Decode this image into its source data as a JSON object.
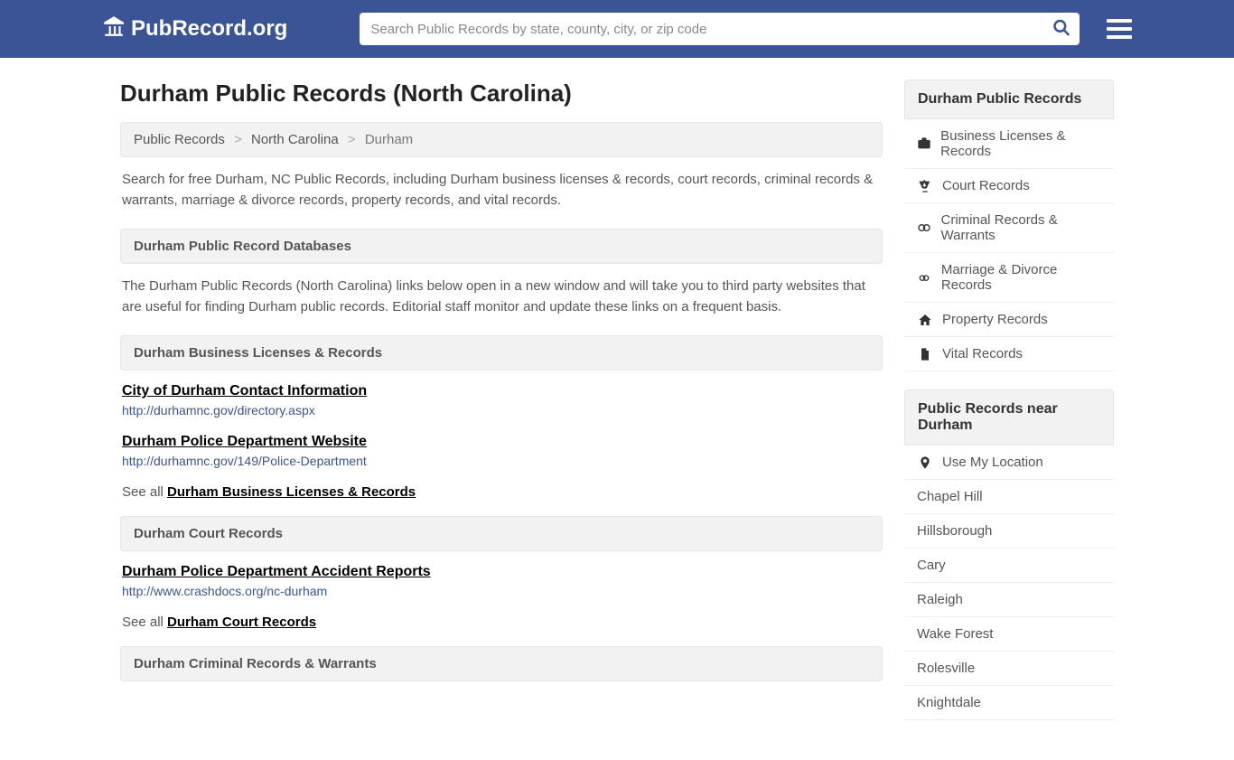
{
  "header": {
    "logo_text": "PubRecord.org",
    "search_placeholder": "Search Public Records by state, county, city, or zip code"
  },
  "page": {
    "title": "Durham Public Records (North Carolina)",
    "breadcrumb": {
      "root": "Public Records",
      "state": "North Carolina",
      "city": "Durham"
    },
    "intro": "Search for free Durham, NC Public Records, including Durham business licenses & records, court records, criminal records & warrants, marriage & divorce records, property records, and vital records.",
    "databases_header": "Durham Public Record Databases",
    "databases_intro": "The Durham Public Records (North Carolina) links below open in a new window and will take you to third party websites that are useful for finding Durham public records. Editorial staff monitor and update these links on a frequent basis.",
    "sections": [
      {
        "header": "Durham Business Licenses & Records",
        "items": [
          {
            "title": "City of Durham Contact Information",
            "url": "http://durhamnc.gov/directory.aspx"
          },
          {
            "title": "Durham Police Department Website",
            "url": "http://durhamnc.gov/149/Police-Department"
          }
        ],
        "see_all_prefix": "See all ",
        "see_all_link": "Durham Business Licenses & Records"
      },
      {
        "header": "Durham Court Records",
        "items": [
          {
            "title": "Durham Police Department Accident Reports",
            "url": "http://www.crashdocs.org/nc-durham"
          }
        ],
        "see_all_prefix": "See all ",
        "see_all_link": "Durham Court Records"
      },
      {
        "header": "Durham Criminal Records & Warrants",
        "items": []
      }
    ]
  },
  "sidebar": {
    "records_header": "Durham Public Records",
    "categories": [
      {
        "label": "Business Licenses & Records",
        "icon": "briefcase"
      },
      {
        "label": "Court Records",
        "icon": "scales"
      },
      {
        "label": "Criminal Records & Warrants",
        "icon": "handcuffs"
      },
      {
        "label": "Marriage & Divorce Records",
        "icon": "rings"
      },
      {
        "label": "Property Records",
        "icon": "home"
      },
      {
        "label": "Vital Records",
        "icon": "file"
      }
    ],
    "near_header": "Public Records near Durham",
    "use_location": "Use My Location",
    "near_places": [
      "Chapel Hill",
      "Hillsborough",
      "Cary",
      "Raleigh",
      "Wake Forest",
      "Rolesville",
      "Knightdale"
    ]
  }
}
